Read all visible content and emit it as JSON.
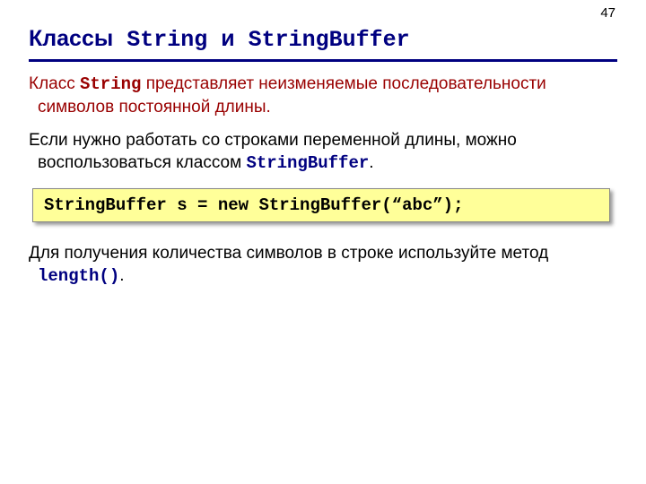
{
  "page_number": "47",
  "title_parts": {
    "p1": "Классы",
    "p2": " String ",
    "p3": "и",
    "p4": " StringBuffer"
  },
  "para1": {
    "a": "Класс ",
    "b": "String",
    "c": " представляет неизменяемые последовательности символов постоянной длины."
  },
  "para2": {
    "a": "Если нужно работать со строками переменной длины, можно воспользоваться классом ",
    "b": "StringBuffer",
    "c": "."
  },
  "code_line": "StringBuffer s = new StringBuffer(“abc”);",
  "para3": {
    "a": "Для получения количества символов в строке используйте метод ",
    "b": "length()",
    "c": "."
  }
}
